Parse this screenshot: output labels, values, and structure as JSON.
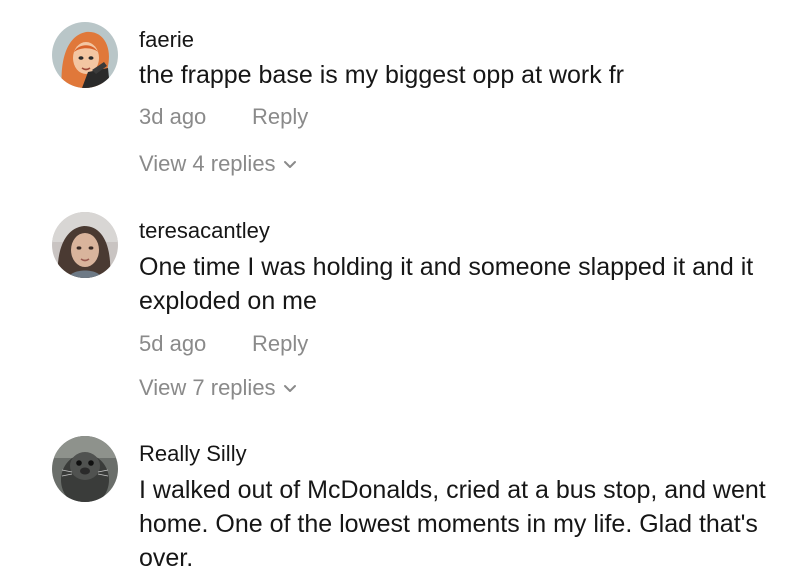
{
  "comments": [
    {
      "username": "faerie",
      "text": "the frappe base is my biggest opp at work fr",
      "time": "3d ago",
      "reply_label": "Reply",
      "view_replies": "View 4 replies",
      "avatar_icon": "cartoon-woman-avatar"
    },
    {
      "username": "teresacantley",
      "text": "One time I was holding it and someone slapped it and it exploded on me",
      "time": "5d ago",
      "reply_label": "Reply",
      "view_replies": "View 7 replies",
      "avatar_icon": "photo-woman-avatar"
    },
    {
      "username": "Really Silly",
      "text": "I walked out of McDonalds, cried at a bus stop, and went home. One of the lowest moments in my life. Glad that's over.",
      "avatar_icon": "seal-photo-avatar"
    }
  ],
  "colors": {
    "text": "#161616",
    "secondary": "#8a8a8a",
    "background": "#ffffff"
  }
}
